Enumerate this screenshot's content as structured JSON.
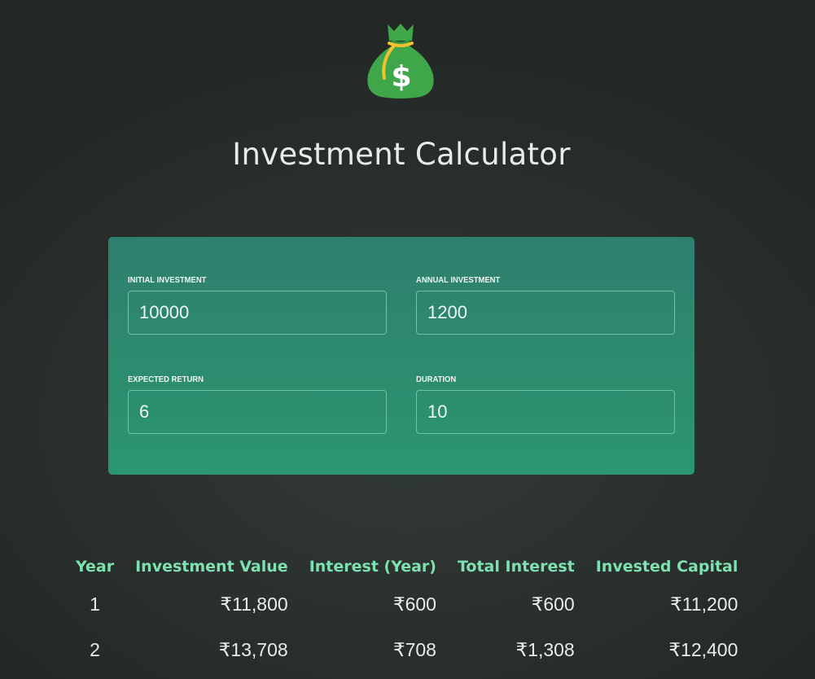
{
  "logo": {
    "icon": "money-bag-icon",
    "symbol": "$",
    "colors": {
      "bag": "#3fa64a",
      "tie": "#f2c12e"
    }
  },
  "header": {
    "title": "Investment Calculator"
  },
  "form": {
    "initial_investment": {
      "label": "Initial Investment",
      "value": "10000"
    },
    "annual_investment": {
      "label": "Annual Investment",
      "value": "1200"
    },
    "expected_return": {
      "label": "Expected Return",
      "value": "6"
    },
    "duration": {
      "label": "Duration",
      "value": "10"
    }
  },
  "table": {
    "headers": [
      "Year",
      "Investment Value",
      "Interest (Year)",
      "Total Interest",
      "Invested Capital"
    ],
    "rows": [
      [
        "1",
        "₹11,800",
        "₹600",
        "₹600",
        "₹11,200"
      ],
      [
        "2",
        "₹13,708",
        "₹708",
        "₹1,308",
        "₹12,400"
      ]
    ]
  },
  "colors": {
    "accent": "#7ee2b0",
    "card_top": "#2f7f6e",
    "card_bottom": "#2b9670",
    "background": "#2b312e"
  }
}
